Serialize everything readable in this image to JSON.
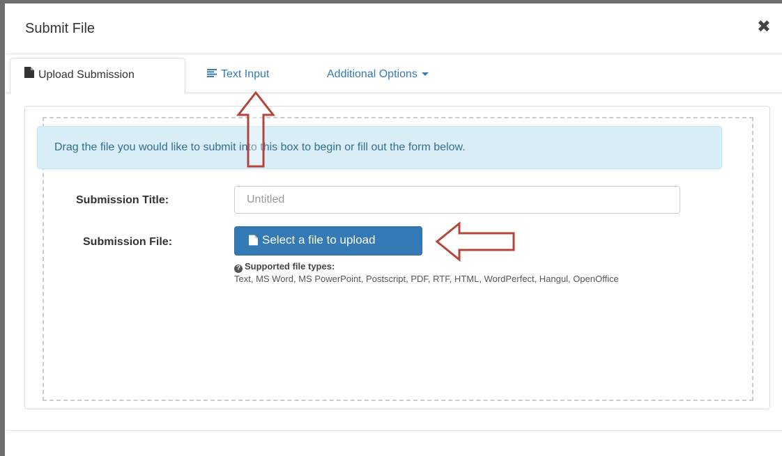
{
  "modal": {
    "title": "Submit File",
    "close_icon": "close-icon"
  },
  "tabs": [
    {
      "label": "Upload Submission",
      "icon": "file-icon",
      "active": true
    },
    {
      "label": "Text Input",
      "icon": "align-left-icon",
      "active": false
    },
    {
      "label": "Additional Options",
      "icon": "caret-down-icon",
      "active": false
    }
  ],
  "dropzone": {
    "message": "Drag the file you would like to submit into this box to begin or fill out the form below."
  },
  "form": {
    "title_label": "Submission Title:",
    "title_placeholder": "Untitled",
    "title_value": "",
    "file_label": "Submission File:",
    "upload_button": "Select a file to upload",
    "supported_heading": "Supported file types:",
    "supported_types": "Text, MS Word, MS PowerPoint, Postscript, PDF, RTF, HTML, WordPerfect, Hangul, OpenOffice"
  },
  "colors": {
    "primary": "#337ab7",
    "alert_bg": "#d9edf7",
    "alert_text": "#31708f",
    "annotation_arrow": "#b5443b"
  }
}
